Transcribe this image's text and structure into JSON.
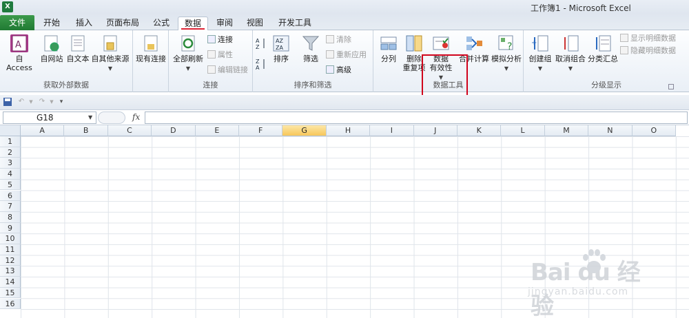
{
  "window": {
    "title": "工作簿1 - Microsoft Excel",
    "app_icon": "X"
  },
  "tabs": {
    "file": "文件",
    "items": [
      "开始",
      "插入",
      "页面布局",
      "公式",
      "数据",
      "审阅",
      "视图",
      "开发工具"
    ],
    "active": "数据"
  },
  "ribbon": {
    "get_external": {
      "label": "获取外部数据",
      "access": "自 Access",
      "web": "自网站",
      "text": "自文本",
      "other": "自其他来源"
    },
    "existing": "现有连接",
    "connections": {
      "label": "连接",
      "refresh_all": "全部刷新",
      "connect": "连接",
      "properties": "属性",
      "edit_links": "编辑链接"
    },
    "sort_filter": {
      "label": "排序和筛选",
      "sort": "排序",
      "filter": "筛选",
      "clear": "清除",
      "reapply": "重新应用",
      "advanced": "高级"
    },
    "data_tools": {
      "label": "数据工具",
      "split": "分列",
      "remove_dup_1": "删除",
      "remove_dup_2": "重复项",
      "validation_1": "数据",
      "validation_2": "有效性",
      "consolidate": "合并计算",
      "whatif": "模拟分析"
    },
    "outline": {
      "label": "分级显示",
      "group": "创建组",
      "ungroup": "取消组合",
      "subtotal": "分类汇总",
      "show_detail": "显示明细数据",
      "hide_detail": "隐藏明细数据"
    }
  },
  "formula_bar": {
    "cell_ref": "G18",
    "fx": "fx",
    "value": ""
  },
  "columns": [
    "A",
    "B",
    "C",
    "D",
    "E",
    "F",
    "G",
    "H",
    "I",
    "J",
    "K",
    "L",
    "M",
    "N",
    "O"
  ],
  "selected_column": "G",
  "rows": [
    "1",
    "2",
    "3",
    "4",
    "5",
    "6",
    "7",
    "8",
    "9",
    "10",
    "11",
    "12",
    "13",
    "14",
    "15",
    "16"
  ],
  "watermark": {
    "brand": "Bai du 经验",
    "url": "jingyan.baidu.com"
  },
  "colors": {
    "file_tab": "#207a33",
    "highlight": "#d0021b",
    "selected_header": "#f7c75a"
  }
}
